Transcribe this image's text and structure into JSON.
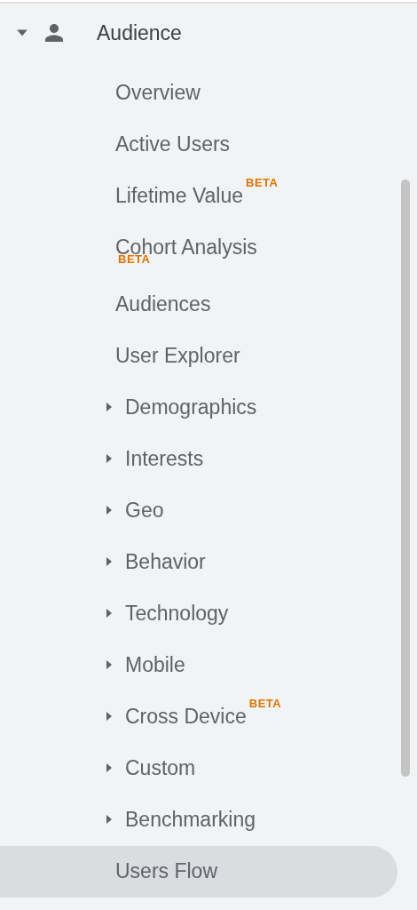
{
  "section": {
    "label": "Audience",
    "expanded": true
  },
  "items": [
    {
      "label": "Overview",
      "kind": "link",
      "selected": false
    },
    {
      "label": "Active Users",
      "kind": "link",
      "selected": false
    },
    {
      "label": "Lifetime Value",
      "kind": "link",
      "selected": false,
      "badge": "BETA"
    },
    {
      "label": "Cohort Analysis",
      "kind": "link",
      "selected": false,
      "badge": "BETA"
    },
    {
      "label": "Audiences",
      "kind": "link",
      "selected": false
    },
    {
      "label": "User Explorer",
      "kind": "link",
      "selected": false
    },
    {
      "label": "Demographics",
      "kind": "expandable",
      "selected": false
    },
    {
      "label": "Interests",
      "kind": "expandable",
      "selected": false
    },
    {
      "label": "Geo",
      "kind": "expandable",
      "selected": false
    },
    {
      "label": "Behavior",
      "kind": "expandable",
      "selected": false
    },
    {
      "label": "Technology",
      "kind": "expandable",
      "selected": false
    },
    {
      "label": "Mobile",
      "kind": "expandable",
      "selected": false
    },
    {
      "label": "Cross Device",
      "kind": "expandable",
      "selected": false,
      "badge": "BETA"
    },
    {
      "label": "Custom",
      "kind": "expandable",
      "selected": false
    },
    {
      "label": "Benchmarking",
      "kind": "expandable",
      "selected": false
    },
    {
      "label": "Users Flow",
      "kind": "link",
      "selected": true
    }
  ]
}
